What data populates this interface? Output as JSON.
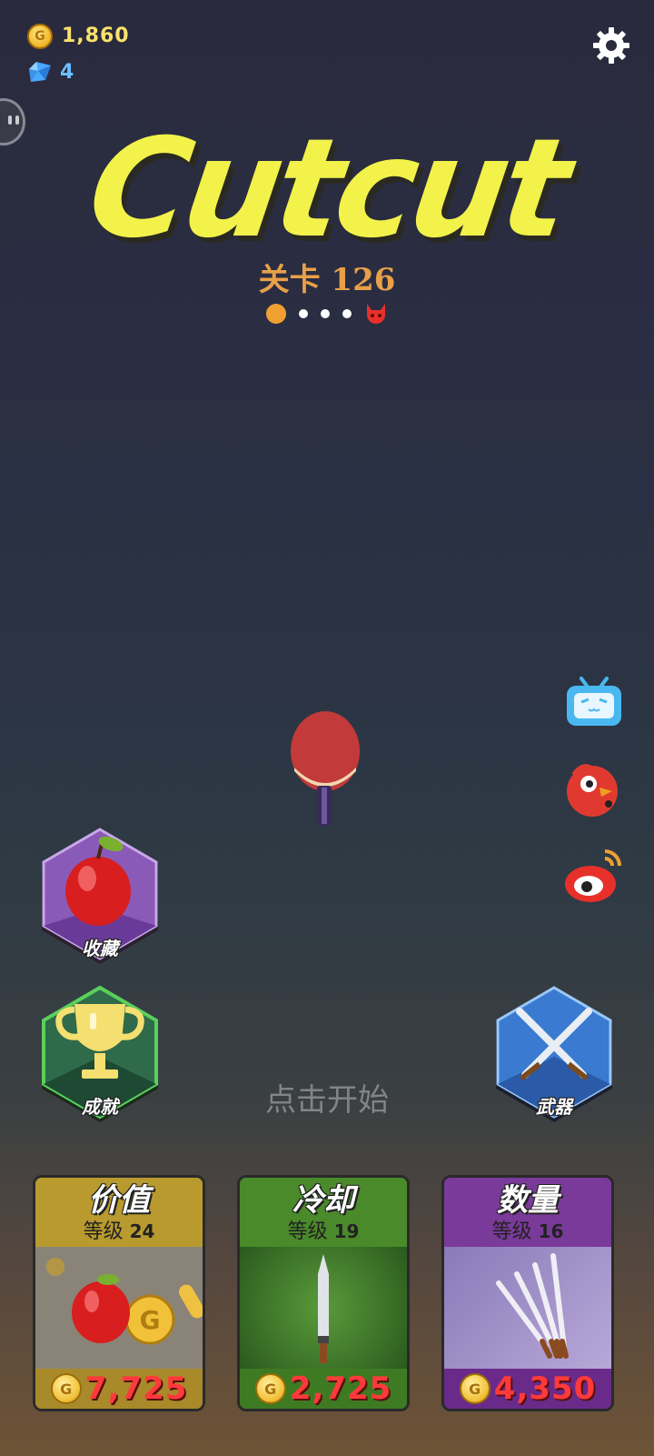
{
  "hud": {
    "coins": "1,860",
    "gems": "4",
    "coin_icon": "coin-icon",
    "gem_icon": "gem-icon",
    "settings_icon": "gear-icon"
  },
  "title": {
    "logo": "Cutcut",
    "level_label": "关卡 126"
  },
  "stage_progress": {
    "current": 1,
    "total": 5,
    "boss_icon": "devil-icon"
  },
  "social": [
    "bilibili-icon",
    "bird-icon",
    "weibo-icon"
  ],
  "buttons": {
    "collection_label": "收藏",
    "achievements_label": "成就",
    "weapons_label": "武器",
    "tap_to_start": "点击开始"
  },
  "cards": [
    {
      "title": "价值",
      "level_prefix": "等级",
      "level": "24",
      "price": "7,725",
      "color": "#b89a2e"
    },
    {
      "title": "冷却",
      "level_prefix": "等级",
      "level": "19",
      "price": "2,725",
      "color": "#4a8a2a"
    },
    {
      "title": "数量",
      "level_prefix": "等级",
      "level": "16",
      "price": "4,350",
      "color": "#7a3a9a"
    }
  ]
}
